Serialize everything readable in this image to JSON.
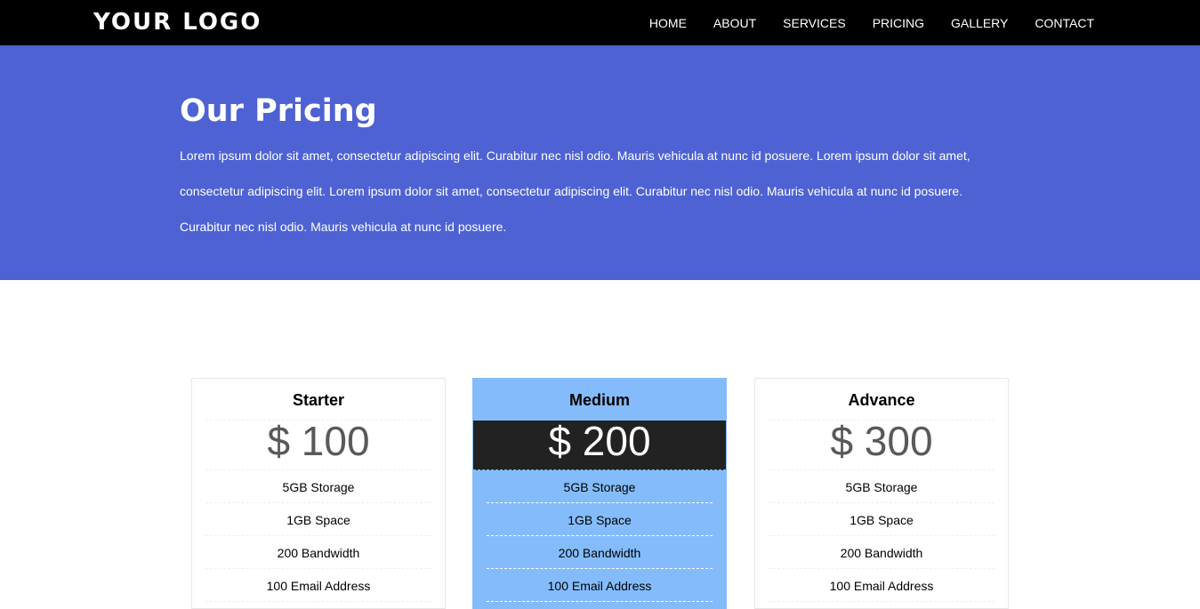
{
  "header": {
    "logo": "YOUR LOGO",
    "nav": [
      "HOME",
      "ABOUT",
      "SERVICES",
      "PRICING",
      "GALLERY",
      "CONTACT"
    ]
  },
  "hero": {
    "title": "Our Pricing",
    "text": "Lorem ipsum dolor sit amet, consectetur adipiscing elit. Curabitur nec nisl odio. Mauris vehicula at nunc id posuere. Lorem ipsum dolor sit amet, consectetur adipiscing elit. Lorem ipsum dolor sit amet, consectetur adipiscing elit. Curabitur nec nisl odio. Mauris vehicula at nunc id posuere. Curabitur nec nisl odio. Mauris vehicula at nunc id posuere."
  },
  "plans": [
    {
      "name": "Starter",
      "price": "$ 100",
      "features": [
        "5GB Storage",
        "1GB Space",
        "200 Bandwidth",
        "100 Email Address"
      ]
    },
    {
      "name": "Medium",
      "price": "$ 200",
      "features": [
        "5GB Storage",
        "1GB Space",
        "200 Bandwidth",
        "100 Email Address"
      ]
    },
    {
      "name": "Advance",
      "price": "$ 300",
      "features": [
        "5GB Storage",
        "1GB Space",
        "200 Bandwidth",
        "100 Email Address"
      ]
    }
  ],
  "colors": {
    "header_bg": "#000000",
    "hero_bg": "#4e62d3",
    "featured_card_bg": "#84bcfb",
    "featured_price_bg": "#222222"
  }
}
